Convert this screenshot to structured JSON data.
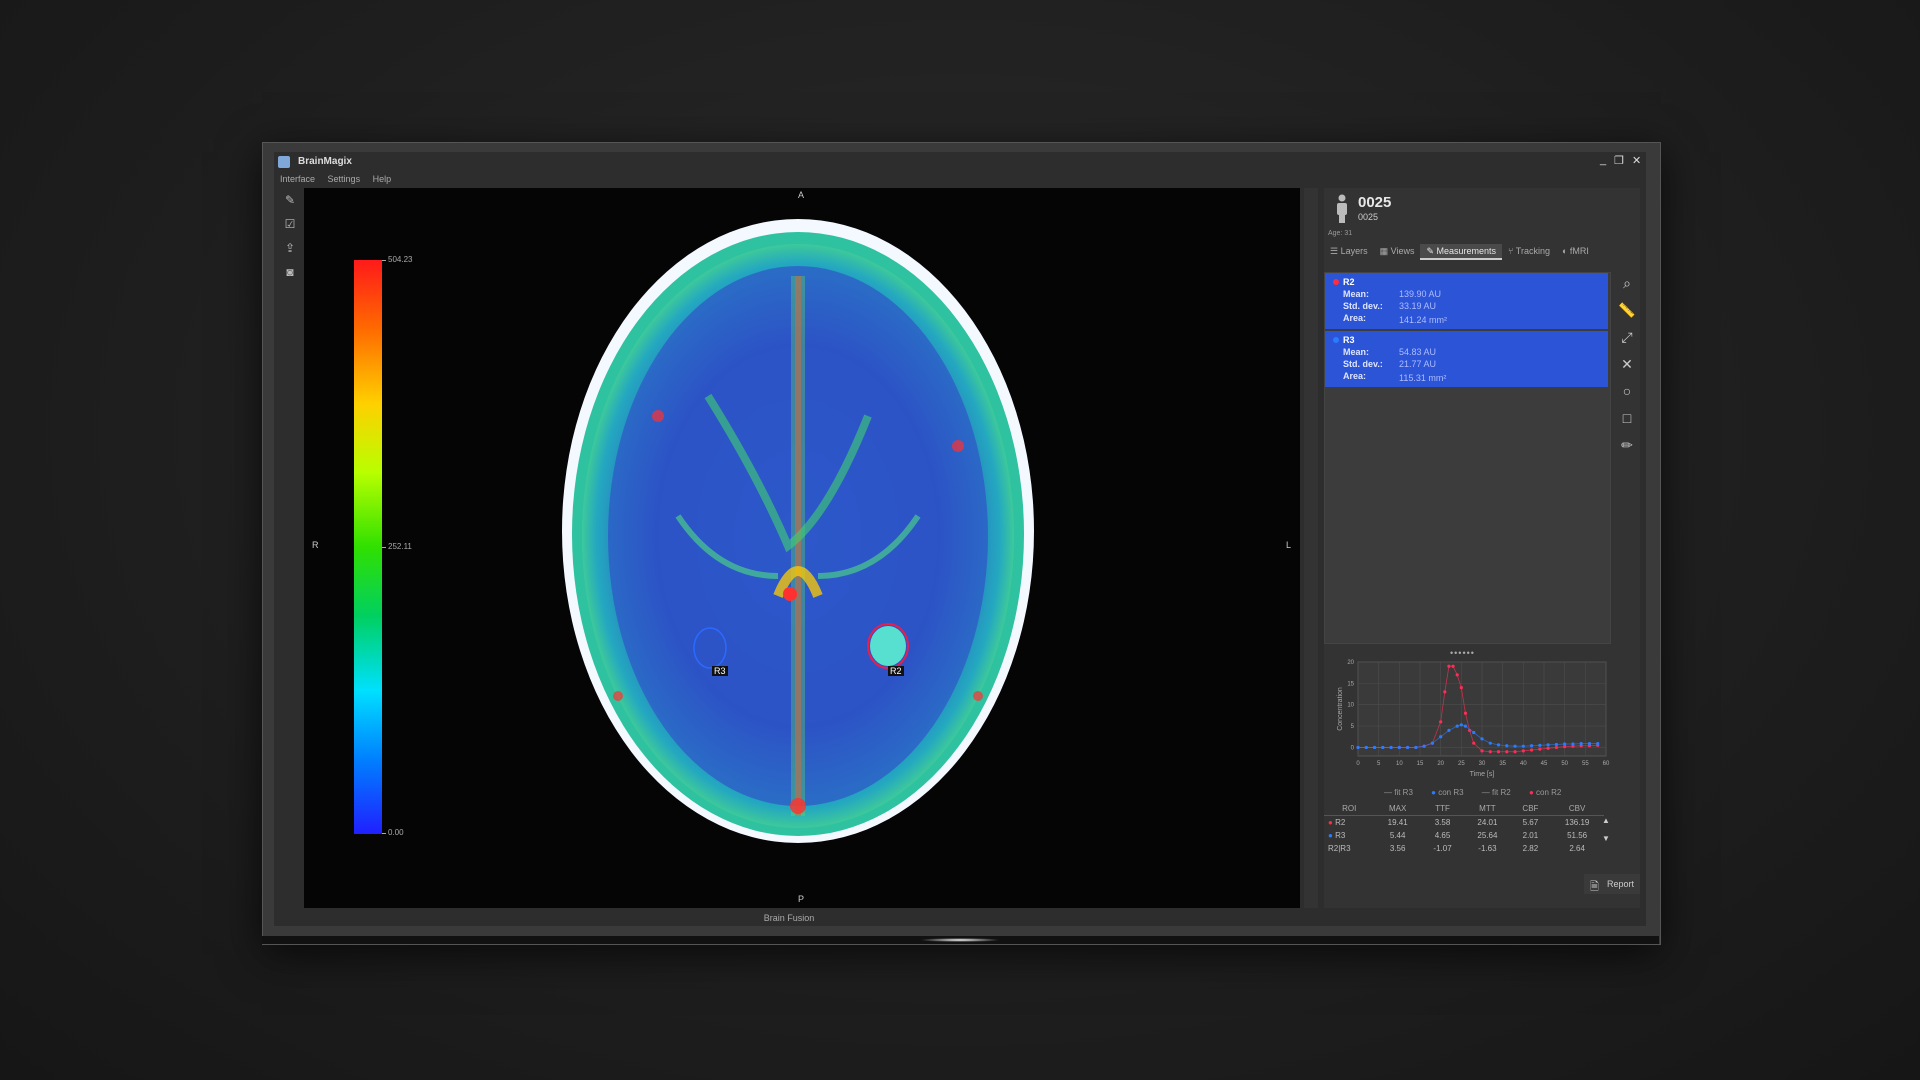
{
  "app": {
    "title": "BrainMagix",
    "menu": [
      "Interface",
      "Settings",
      "Help"
    ]
  },
  "window_controls": {
    "minimize": "_",
    "restore": "❐",
    "close": "✕"
  },
  "viewer": {
    "orientation": {
      "top": "A",
      "bottom": "P",
      "left": "R",
      "right": "L"
    },
    "colorbar": {
      "max": "504.23",
      "mid": "252.11",
      "min": "0.00"
    },
    "rois": [
      {
        "label": "R3"
      },
      {
        "label": "R2"
      }
    ],
    "status": "Brain Fusion"
  },
  "patient": {
    "id": "0025",
    "subtitle": "0025",
    "age": "Age: 31"
  },
  "tabs": [
    {
      "label": "Layers",
      "icon": "list-icon"
    },
    {
      "label": "Views",
      "icon": "grid-icon"
    },
    {
      "label": "Measurements",
      "icon": "edit-icon"
    },
    {
      "label": "Tracking",
      "icon": "tracking-icon"
    },
    {
      "label": "fMRI",
      "icon": "fmri-icon"
    }
  ],
  "measurements": [
    {
      "name": "R2",
      "color": "#ff2d3d",
      "mean_label": "Mean:",
      "mean": "139.90 AU",
      "sd_label": "Std. dev.:",
      "sd": "33.19 AU",
      "area_label": "Area:",
      "area": "141.24 mm²"
    },
    {
      "name": "R3",
      "color": "#2a7bff",
      "mean_label": "Mean:",
      "mean": "54.83 AU",
      "sd_label": "Std. dev.:",
      "sd": "21.77 AU",
      "area_label": "Area:",
      "area": "115.31 mm²"
    }
  ],
  "chart_data": {
    "type": "scatter",
    "xlabel": "Time [s]",
    "ylabel": "Concentration",
    "xlim": [
      0,
      60
    ],
    "ylim": [
      -2,
      20
    ],
    "xticks": [
      0,
      5,
      10,
      15,
      20,
      25,
      30,
      35,
      40,
      45,
      50,
      55,
      60
    ],
    "yticks": [
      0,
      5,
      10,
      15,
      20
    ],
    "grid": true,
    "series": [
      {
        "name": "con R2",
        "color": "#ff2d55",
        "x": [
          0,
          2,
          4,
          6,
          8,
          10,
          12,
          14,
          16,
          18,
          20,
          21,
          22,
          23,
          24,
          25,
          26,
          27,
          28,
          30,
          32,
          34,
          36,
          38,
          40,
          42,
          44,
          46,
          48,
          50,
          52,
          54,
          56,
          58
        ],
        "y": [
          0,
          0,
          0,
          0,
          0,
          0,
          0,
          0,
          0.3,
          1,
          6,
          13,
          19,
          19,
          17,
          14,
          8,
          4,
          1,
          -0.8,
          -1,
          -1,
          -1,
          -1,
          -0.8,
          -0.6,
          -0.4,
          -0.2,
          0,
          0.2,
          0.3,
          0.4,
          0.4,
          0.5
        ]
      },
      {
        "name": "con R3",
        "color": "#2a7bff",
        "x": [
          0,
          2,
          4,
          6,
          8,
          10,
          12,
          14,
          16,
          18,
          20,
          22,
          24,
          25,
          26,
          28,
          30,
          32,
          34,
          36,
          38,
          40,
          42,
          44,
          46,
          48,
          50,
          52,
          54,
          56,
          58
        ],
        "y": [
          0,
          0,
          0,
          0,
          0,
          0,
          0,
          0,
          0.3,
          1,
          2.5,
          4,
          5,
          5.3,
          5,
          3.5,
          2,
          1,
          0.6,
          0.4,
          0.3,
          0.3,
          0.4,
          0.5,
          0.6,
          0.7,
          0.8,
          0.8,
          0.9,
          0.9,
          0.9
        ]
      },
      {
        "name": "fit R3",
        "color": "#7aa6ff",
        "x": [],
        "y": []
      },
      {
        "name": "fit R2",
        "color": "#ff8aa0",
        "x": [],
        "y": []
      }
    ]
  },
  "table": {
    "headers": [
      "ROI",
      "MAX",
      "TTF",
      "MTT",
      "CBF",
      "CBV"
    ],
    "rows": [
      {
        "roi": "R2",
        "color": "#ff2d3d",
        "vals": [
          "19.41",
          "3.58",
          "24.01",
          "5.67",
          "136.19"
        ]
      },
      {
        "roi": "R3",
        "color": "#2a7bff",
        "vals": [
          "5.44",
          "4.65",
          "25.64",
          "2.01",
          "51.56"
        ]
      },
      {
        "roi": "R2|R3",
        "color": "",
        "vals": [
          "3.56",
          "-1.07",
          "-1.63",
          "2.82",
          "2.64"
        ]
      }
    ]
  },
  "report": {
    "label": "Report"
  }
}
